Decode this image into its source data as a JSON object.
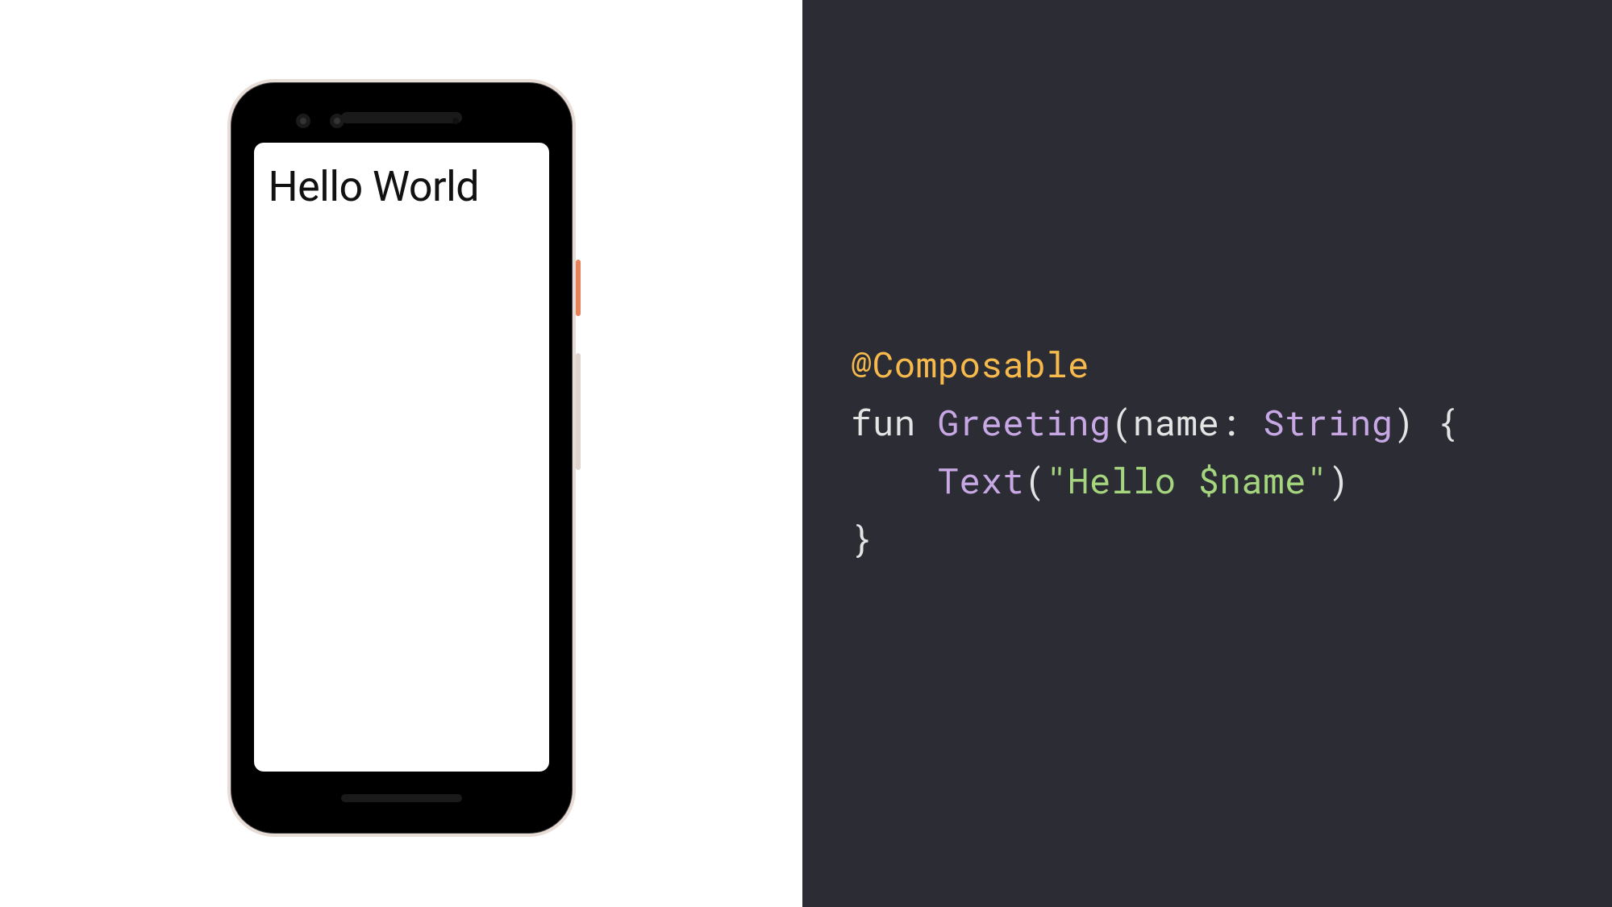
{
  "preview": {
    "screen_text": "Hello World"
  },
  "code": {
    "annotation": "@Composable",
    "keyword_fun": "fun",
    "function_name": "Greeting",
    "param_name": "name",
    "param_sep": ": ",
    "param_type": "String",
    "open": ") {",
    "popen": "(",
    "call_name": "Text",
    "call_open": "(",
    "string_literal": "\"Hello $name\"",
    "call_close": ")",
    "close_brace": "}",
    "indent": "    "
  }
}
